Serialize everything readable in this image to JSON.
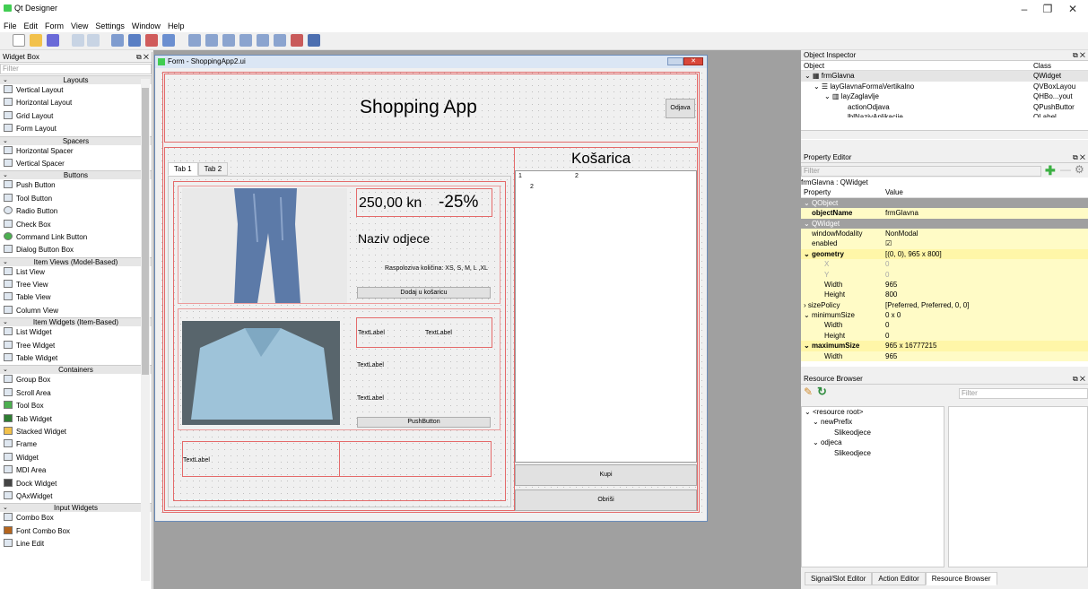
{
  "app": {
    "title": "Qt Designer"
  },
  "window_buttons": {
    "minimize": "–",
    "maximize": "❐",
    "close": "✕"
  },
  "menu": [
    "File",
    "Edit",
    "Form",
    "View",
    "Settings",
    "Window",
    "Help"
  ],
  "widget_box": {
    "title": "Widget Box",
    "filter_placeholder": "Filter",
    "categories": [
      {
        "name": "Layouts",
        "items": [
          "Vertical Layout",
          "Horizontal Layout",
          "Grid Layout",
          "Form Layout"
        ]
      },
      {
        "name": "Spacers",
        "items": [
          "Horizontal Spacer",
          "Vertical Spacer"
        ]
      },
      {
        "name": "Buttons",
        "items": [
          "Push Button",
          "Tool Button",
          "Radio Button",
          "Check Box",
          "Command Link Button",
          "Dialog Button Box"
        ]
      },
      {
        "name": "Item Views (Model-Based)",
        "items": [
          "List View",
          "Tree View",
          "Table View",
          "Column View"
        ]
      },
      {
        "name": "Item Widgets (Item-Based)",
        "items": [
          "List Widget",
          "Tree Widget",
          "Table Widget"
        ]
      },
      {
        "name": "Containers",
        "items": [
          "Group Box",
          "Scroll Area",
          "Tool Box",
          "Tab Widget",
          "Stacked Widget",
          "Frame",
          "Widget",
          "MDI Area",
          "Dock Widget",
          "QAxWidget"
        ]
      },
      {
        "name": "Input Widgets",
        "items": [
          "Combo Box",
          "Font Combo Box",
          "Line Edit"
        ]
      }
    ]
  },
  "form": {
    "window_title": "Form - ShoppingApp2.ui",
    "header_title": "Shopping App",
    "logout_button": "Odjava",
    "tabs": [
      "Tab 1",
      "Tab 2"
    ],
    "item1": {
      "price": "250,00 kn",
      "discount": "-25%",
      "name": "Naziv odjece",
      "sizes": "Raspoloziva količina: XS, S, M, L ,XL",
      "add_button": "Dodaj u košaricu"
    },
    "item2": {
      "label1": "TextLabel",
      "label2": "TextLabel",
      "label3": "TextLabel",
      "label4": "TextLabel",
      "button": "PushButton"
    },
    "item3": {
      "label": "TextLabel"
    },
    "cart": {
      "title": "Košarica",
      "list_col1": "1",
      "list_col2": "2",
      "list_row": "2",
      "buy_button": "Kupi",
      "delete_button": "Obriši"
    }
  },
  "object_inspector": {
    "title": "Object Inspector",
    "col_object": "Object",
    "col_class": "Class",
    "rows": [
      {
        "name": "frmGlavna",
        "cls": "QWidget"
      },
      {
        "name": "layGlavnaFormaVertikalno",
        "cls": "QVBoxLayou"
      },
      {
        "name": "layZaglavlje",
        "cls": "QHBo...yout"
      },
      {
        "name": "actionOdjava",
        "cls": "QPushButtor"
      },
      {
        "name": "lblNazivAplikacije",
        "cls": "QLabel"
      }
    ]
  },
  "property_editor": {
    "title": "Property Editor",
    "filter_placeholder": "Filter",
    "context": "frmGlavna : QWidget",
    "col_property": "Property",
    "col_value": "Value",
    "rows": [
      {
        "p": "QObject",
        "v": ""
      },
      {
        "p": "objectName",
        "v": "frmGlavna"
      },
      {
        "p": "QWidget",
        "v": ""
      },
      {
        "p": "windowModality",
        "v": "NonModal"
      },
      {
        "p": "enabled",
        "v": "☑"
      },
      {
        "p": "geometry",
        "v": "[(0, 0), 965 x 800]"
      },
      {
        "p": "X",
        "v": "0"
      },
      {
        "p": "Y",
        "v": "0"
      },
      {
        "p": "Width",
        "v": "965"
      },
      {
        "p": "Height",
        "v": "800"
      },
      {
        "p": "sizePolicy",
        "v": "[Preferred, Preferred, 0, 0]"
      },
      {
        "p": "minimumSize",
        "v": "0 x 0"
      },
      {
        "p": "Width",
        "v": "0"
      },
      {
        "p": "Height",
        "v": "0"
      },
      {
        "p": "maximumSize",
        "v": "965 x 16777215"
      },
      {
        "p": "Width",
        "v": "965"
      }
    ]
  },
  "resource_browser": {
    "title": "Resource Browser",
    "filter_placeholder": "Filter",
    "tree": [
      "<resource root>",
      "newPrefix",
      "Slikeodjece",
      "odjeca",
      "Slikeodjece"
    ],
    "bottom_tabs": [
      "Signal/Slot Editor",
      "Action Editor",
      "Resource Browser"
    ]
  }
}
